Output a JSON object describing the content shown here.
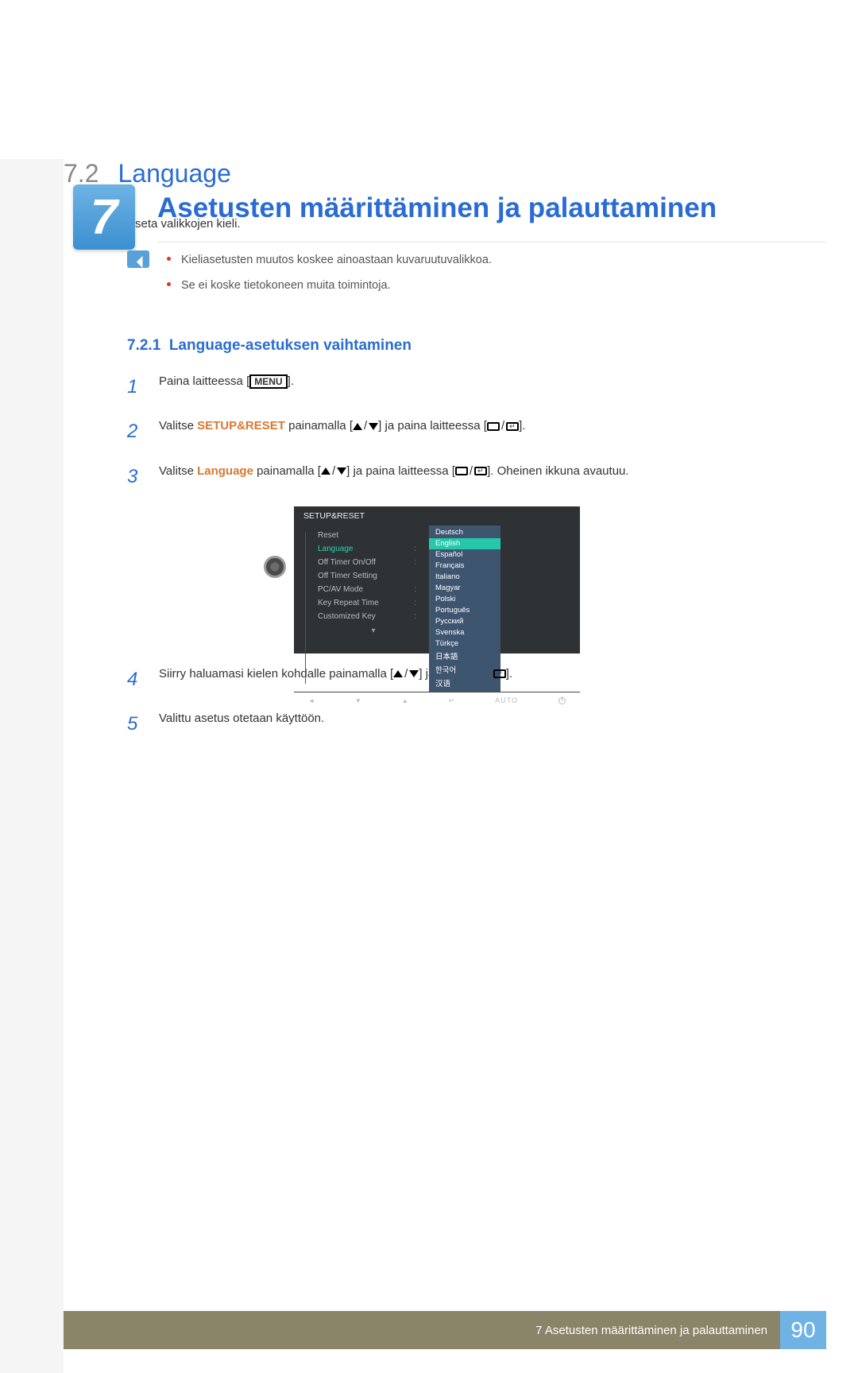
{
  "chapter": {
    "number": "7",
    "title": "Asetusten määrittäminen ja palauttaminen"
  },
  "section": {
    "num": "7.2",
    "title": "Language"
  },
  "intro": "Aseta valikkojen kieli.",
  "notes": [
    "Kieliasetusten muutos koskee ainoastaan kuvaruutuvalikkoa.",
    "Se ei koske tietokoneen muita toimintoja."
  ],
  "subsection": {
    "num": "7.2.1",
    "title": "Language-asetuksen vaihtaminen"
  },
  "steps": {
    "1": {
      "pre": "Paina laitteessa [",
      "menu": "MENU",
      "post": "]."
    },
    "2": {
      "a": "Valitse ",
      "b": "SETUP&RESET",
      "c": " painamalla [",
      "d": "] ja paina laitteessa [",
      "e": "]."
    },
    "3": {
      "a": "Valitse ",
      "b": "Language",
      "c": " painamalla [",
      "d": "] ja paina laitteessa [",
      "e": "]. Oheinen ikkuna avautuu."
    },
    "4": {
      "a": "Siirry haluamasi kielen kohdalle painamalla [",
      "b": "] ja paina [",
      "c": "]."
    },
    "5": "Valittu asetus otetaan käyttöön."
  },
  "osd": {
    "title": "SETUP&RESET",
    "left": [
      "Reset",
      "Language",
      "Off Timer On/Off",
      "Off Timer Setting",
      "PC/AV Mode",
      "Key Repeat Time",
      "Customized Key"
    ],
    "right": [
      "Deutsch",
      "English",
      "Español",
      "Français",
      "Italiano",
      "Magyar",
      "Polski",
      "Português",
      "Русский",
      "Svenska",
      "Türkçe",
      "日本語",
      "한국어",
      "汉语"
    ],
    "selected": "English",
    "bottom_auto": "AUTO"
  },
  "footer": {
    "text": "7 Asetusten määrittäminen ja palauttaminen",
    "page": "90"
  }
}
